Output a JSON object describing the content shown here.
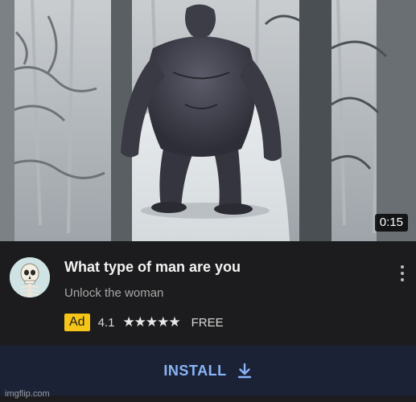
{
  "video": {
    "duration": "0:15"
  },
  "ad": {
    "title": "What type of man are you",
    "subtitle": "Unlock the woman",
    "badge": "Ad",
    "rating": "4.1",
    "stars": "★★★★★",
    "price": "FREE",
    "install_label": "INSTALL"
  },
  "icons": {
    "avatar": "skeleton-icon",
    "more": "more-vert-icon",
    "install": "download-icon"
  },
  "colors": {
    "ad_badge": "#f5c518",
    "install_text": "#8ab4f8",
    "install_bg": "#1b2235",
    "card_bg": "#1c1c1e"
  },
  "watermark": "imgflip.com"
}
